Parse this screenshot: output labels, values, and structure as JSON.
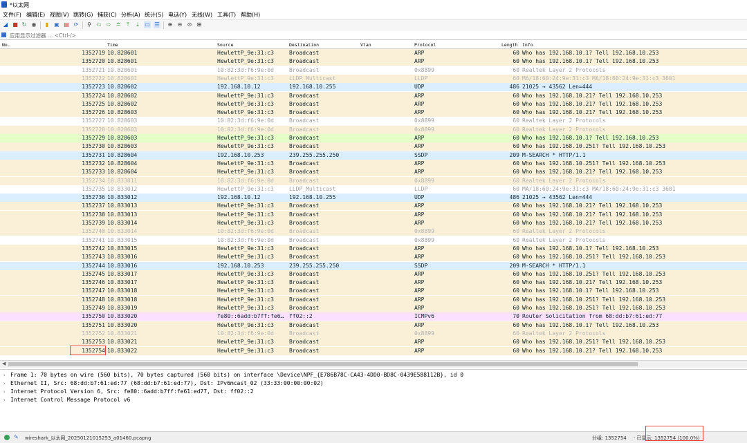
{
  "window": {
    "title": "*以太网"
  },
  "menu": [
    "文件(F)",
    "编辑(E)",
    "视图(V)",
    "跳转(G)",
    "捕获(C)",
    "分析(A)",
    "统计(S)",
    "电话(Y)",
    "无线(W)",
    "工具(T)",
    "帮助(H)"
  ],
  "filter": {
    "placeholder": "应用显示过滤器 … <Ctrl-/>"
  },
  "columns": {
    "no": "No.",
    "time": "Time",
    "source": "Source",
    "destination": "Destination",
    "vlan": "Vlan",
    "protocol": "Protocol",
    "length": "Length",
    "info": "Info"
  },
  "packets": [
    {
      "no": "1352719",
      "time": "10.828601",
      "src": "HewlettP_9e:31:c3",
      "dst": "Broadcast",
      "proto": "ARP",
      "len": "60",
      "info": "Who has 192.168.10.1? Tell 192.168.10.253",
      "cls": "arp"
    },
    {
      "no": "1352720",
      "time": "10.828601",
      "src": "HewlettP_9e:31:c3",
      "dst": "Broadcast",
      "proto": "ARP",
      "len": "60",
      "info": "Who has 192.168.10.1? Tell 192.168.10.253",
      "cls": "arp"
    },
    {
      "no": "1352721",
      "time": "10.828601",
      "src": "10:82:3d:f6:9e:0d",
      "dst": "Broadcast",
      "proto": "0x8899",
      "len": "60",
      "info": "Realtek Layer 2 Protocols",
      "cls": "gray"
    },
    {
      "no": "1352722",
      "time": "10.828601",
      "src": "HewlettP_9e:31:c3",
      "dst": "LLDP_Multicast",
      "proto": "LLDP",
      "len": "60",
      "info": "MA/18:60:24:9e:31:c3 MA/18:60:24:9e:31:c3 3601",
      "cls": "gray"
    },
    {
      "no": "1352723",
      "time": "10.828602",
      "src": "192.168.10.12",
      "dst": "192.168.10.255",
      "proto": "UDP",
      "len": "486",
      "info": "21025 → 43562 Len=444",
      "cls": "udp"
    },
    {
      "no": "1352724",
      "time": "10.828602",
      "src": "HewlettP_9e:31:c3",
      "dst": "Broadcast",
      "proto": "ARP",
      "len": "60",
      "info": "Who has 192.168.10.21? Tell 192.168.10.253",
      "cls": "arp"
    },
    {
      "no": "1352725",
      "time": "10.828602",
      "src": "HewlettP_9e:31:c3",
      "dst": "Broadcast",
      "proto": "ARP",
      "len": "60",
      "info": "Who has 192.168.10.21? Tell 192.168.10.253",
      "cls": "arp"
    },
    {
      "no": "1352726",
      "time": "10.828603",
      "src": "HewlettP_9e:31:c3",
      "dst": "Broadcast",
      "proto": "ARP",
      "len": "60",
      "info": "Who has 192.168.10.21? Tell 192.168.10.253",
      "cls": "arp"
    },
    {
      "no": "1352727",
      "time": "10.828603",
      "src": "10:82:3d:f6:9e:0d",
      "dst": "Broadcast",
      "proto": "0x8899",
      "len": "60",
      "info": "Realtek Layer 2 Protocols",
      "cls": "gray"
    },
    {
      "no": "1352728",
      "time": "10.828603",
      "src": "10:82:3d:f6:9e:0d",
      "dst": "Broadcast",
      "proto": "0x8899",
      "len": "60",
      "info": "Realtek Layer 2 Protocols",
      "cls": "gray"
    },
    {
      "no": "1352729",
      "time": "10.828603",
      "src": "HewlettP_9e:31:c3",
      "dst": "Broadcast",
      "proto": "ARP",
      "len": "60",
      "info": "Who has 192.168.10.1? Tell 192.168.10.253",
      "cls": "green"
    },
    {
      "no": "1352730",
      "time": "10.828603",
      "src": "HewlettP_9e:31:c3",
      "dst": "Broadcast",
      "proto": "ARP",
      "len": "60",
      "info": "Who has 192.168.10.251? Tell 192.168.10.253",
      "cls": "arp"
    },
    {
      "no": "1352731",
      "time": "10.828604",
      "src": "192.168.10.253",
      "dst": "239.255.255.250",
      "proto": "SSDP",
      "len": "209",
      "info": "M-SEARCH * HTTP/1.1",
      "cls": "udp"
    },
    {
      "no": "1352732",
      "time": "10.828604",
      "src": "HewlettP_9e:31:c3",
      "dst": "Broadcast",
      "proto": "ARP",
      "len": "60",
      "info": "Who has 192.168.10.251? Tell 192.168.10.253",
      "cls": "arp"
    },
    {
      "no": "1352733",
      "time": "10.828604",
      "src": "HewlettP_9e:31:c3",
      "dst": "Broadcast",
      "proto": "ARP",
      "len": "60",
      "info": "Who has 192.168.10.21? Tell 192.168.10.253",
      "cls": "arp"
    },
    {
      "no": "1352734",
      "time": "10.833011",
      "src": "10:82:3d:f6:9e:0d",
      "dst": "Broadcast",
      "proto": "0x8899",
      "len": "60",
      "info": "Realtek Layer 2 Protocols",
      "cls": "gray"
    },
    {
      "no": "1352735",
      "time": "10.833012",
      "src": "HewlettP_9e:31:c3",
      "dst": "LLDP_Multicast",
      "proto": "LLDP",
      "len": "60",
      "info": "MA/18:60:24:9e:31:c3 MA/18:60:24:9e:31:c3 3601",
      "cls": "gray"
    },
    {
      "no": "1352736",
      "time": "10.833012",
      "src": "192.168.10.12",
      "dst": "192.168.10.255",
      "proto": "UDP",
      "len": "486",
      "info": "21025 → 43562 Len=444",
      "cls": "udp"
    },
    {
      "no": "1352737",
      "time": "10.833013",
      "src": "HewlettP_9e:31:c3",
      "dst": "Broadcast",
      "proto": "ARP",
      "len": "60",
      "info": "Who has 192.168.10.21? Tell 192.168.10.253",
      "cls": "arp"
    },
    {
      "no": "1352738",
      "time": "10.833013",
      "src": "HewlettP_9e:31:c3",
      "dst": "Broadcast",
      "proto": "ARP",
      "len": "60",
      "info": "Who has 192.168.10.21? Tell 192.168.10.253",
      "cls": "arp"
    },
    {
      "no": "1352739",
      "time": "10.833014",
      "src": "HewlettP_9e:31:c3",
      "dst": "Broadcast",
      "proto": "ARP",
      "len": "60",
      "info": "Who has 192.168.10.21? Tell 192.168.10.253",
      "cls": "arp"
    },
    {
      "no": "1352740",
      "time": "10.833014",
      "src": "10:82:3d:f6:9e:0d",
      "dst": "Broadcast",
      "proto": "0x8899",
      "len": "60",
      "info": "Realtek Layer 2 Protocols",
      "cls": "gray"
    },
    {
      "no": "1352741",
      "time": "10.833015",
      "src": "10:82:3d:f6:9e:0d",
      "dst": "Broadcast",
      "proto": "0x8899",
      "len": "60",
      "info": "Realtek Layer 2 Protocols",
      "cls": "gray"
    },
    {
      "no": "1352742",
      "time": "10.833015",
      "src": "HewlettP_9e:31:c3",
      "dst": "Broadcast",
      "proto": "ARP",
      "len": "60",
      "info": "Who has 192.168.10.1? Tell 192.168.10.253",
      "cls": "arp"
    },
    {
      "no": "1352743",
      "time": "10.833016",
      "src": "HewlettP_9e:31:c3",
      "dst": "Broadcast",
      "proto": "ARP",
      "len": "60",
      "info": "Who has 192.168.10.251? Tell 192.168.10.253",
      "cls": "arp"
    },
    {
      "no": "1352744",
      "time": "10.833016",
      "src": "192.168.10.253",
      "dst": "239.255.255.250",
      "proto": "SSDP",
      "len": "209",
      "info": "M-SEARCH * HTTP/1.1",
      "cls": "udp"
    },
    {
      "no": "1352745",
      "time": "10.833017",
      "src": "HewlettP_9e:31:c3",
      "dst": "Broadcast",
      "proto": "ARP",
      "len": "60",
      "info": "Who has 192.168.10.251? Tell 192.168.10.253",
      "cls": "arp"
    },
    {
      "no": "1352746",
      "time": "10.833017",
      "src": "HewlettP_9e:31:c3",
      "dst": "Broadcast",
      "proto": "ARP",
      "len": "60",
      "info": "Who has 192.168.10.21? Tell 192.168.10.253",
      "cls": "arp"
    },
    {
      "no": "1352747",
      "time": "10.833018",
      "src": "HewlettP_9e:31:c3",
      "dst": "Broadcast",
      "proto": "ARP",
      "len": "60",
      "info": "Who has 192.168.10.1? Tell 192.168.10.253",
      "cls": "arp"
    },
    {
      "no": "1352748",
      "time": "10.833018",
      "src": "HewlettP_9e:31:c3",
      "dst": "Broadcast",
      "proto": "ARP",
      "len": "60",
      "info": "Who has 192.168.10.251? Tell 192.168.10.253",
      "cls": "arp"
    },
    {
      "no": "1352749",
      "time": "10.833019",
      "src": "HewlettP_9e:31:c3",
      "dst": "Broadcast",
      "proto": "ARP",
      "len": "60",
      "info": "Who has 192.168.10.251? Tell 192.168.10.253",
      "cls": "arp"
    },
    {
      "no": "1352750",
      "time": "10.833020",
      "src": "fe80::6add:b7ff:fe6…",
      "dst": "ff02::2",
      "proto": "ICMPv6",
      "len": "70",
      "info": "Router Solicitation from 68:dd:b7:61:ed:77",
      "cls": "icmp"
    },
    {
      "no": "1352751",
      "time": "10.833020",
      "src": "HewlettP_9e:31:c3",
      "dst": "Broadcast",
      "proto": "ARP",
      "len": "60",
      "info": "Who has 192.168.10.1? Tell 192.168.10.253",
      "cls": "arp"
    },
    {
      "no": "1352752",
      "time": "10.833021",
      "src": "10:82:3d:f6:9e:0d",
      "dst": "Broadcast",
      "proto": "0x8899",
      "len": "60",
      "info": "Realtek Layer 2 Protocols",
      "cls": "gray"
    },
    {
      "no": "1352753",
      "time": "10.833021",
      "src": "HewlettP_9e:31:c3",
      "dst": "Broadcast",
      "proto": "ARP",
      "len": "60",
      "info": "Who has 192.168.10.251? Tell 192.168.10.253",
      "cls": "arp"
    },
    {
      "no": "1352754",
      "time": "10.833022",
      "src": "HewlettP_9e:31:c3",
      "dst": "Broadcast",
      "proto": "ARP",
      "len": "60",
      "info": "Who has 192.168.10.21? Tell 192.168.10.253",
      "cls": "arp"
    }
  ],
  "details": [
    "Frame 1: 70 bytes on wire (560 bits), 70 bytes captured (560 bits) on interface \\Device\\NPF_{E786B78C-CA43-4DD0-BD8C-0439E588112B}, id 0",
    "Ethernet II, Src: 68:dd:b7:61:ed:77 (68:dd:b7:61:ed:77), Dst: IPv6mcast_02 (33:33:00:00:00:02)",
    "Internet Protocol Version 6, Src: fe80::6add:b7ff:fe61:ed77, Dst: ff02::2",
    "Internet Control Message Protocol v6"
  ],
  "status": {
    "file": "wireshark_以太网_20250121015253_a01460.pcapng",
    "packets": "分组: 1352754",
    "displayed": "· 已显示: 1352754 (100.0%)"
  }
}
